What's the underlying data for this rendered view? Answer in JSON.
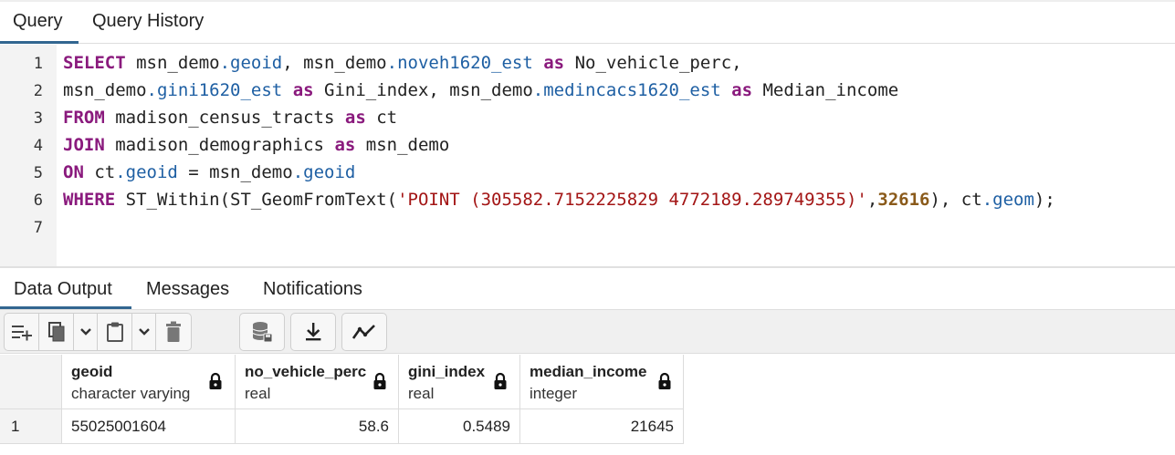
{
  "query_panel": {
    "tabs": [
      {
        "label": "Query",
        "active": true
      },
      {
        "label": "Query History",
        "active": false
      }
    ],
    "line_numbers": [
      "1",
      "2",
      "3",
      "4",
      "5",
      "6",
      "7"
    ],
    "code": {
      "l1": {
        "kw1": "SELECT",
        "t1": " msn_demo",
        "p1": ".geoid",
        "t2": ", msn_demo",
        "p2": ".noveh1620_est",
        "t3": " ",
        "kw2": "as",
        "t4": " No_vehicle_perc,"
      },
      "l2": {
        "t1": "msn_demo",
        "p1": ".gini1620_est",
        "t2": " ",
        "kw1": "as",
        "t3": " Gini_index, msn_demo",
        "p2": ".medincacs1620_est",
        "t4": " ",
        "kw2": "as",
        "t5": " Median_income"
      },
      "l3": {
        "kw1": "FROM",
        "t1": " madison_census_tracts ",
        "kw2": "as",
        "t2": " ct"
      },
      "l4": {
        "kw1": "JOIN",
        "t1": " madison_demographics ",
        "kw2": "as",
        "t2": " msn_demo"
      },
      "l5": {
        "kw1": "ON",
        "t1": " ct",
        "p1": ".geoid",
        "t2": " = msn_demo",
        "p2": ".geoid"
      },
      "l6": {
        "kw1": "WHERE",
        "t1": " ST_Within(ST_GeomFromText(",
        "s1": "'POINT (305582.7152225829 4772189.289749355)'",
        "t2": ",",
        "n1": "32616",
        "t3": "), ct",
        "p1": ".geom",
        "t4": ");"
      }
    }
  },
  "output_panel": {
    "tabs": [
      {
        "label": "Data Output",
        "active": true
      },
      {
        "label": "Messages",
        "active": false
      },
      {
        "label": "Notifications",
        "active": false
      }
    ],
    "toolbar_icons": [
      "add-row-icon",
      "copy-icon",
      "chevron-down-icon",
      "paste-icon",
      "chevron-down-icon",
      "delete-icon",
      "save-data-icon",
      "download-icon",
      "graph-visualiser-icon"
    ],
    "columns": [
      {
        "name": "geoid",
        "type": "character varying",
        "locked": true
      },
      {
        "name": "no_vehicle_perc",
        "type": "real",
        "locked": true
      },
      {
        "name": "gini_index",
        "type": "real",
        "locked": true
      },
      {
        "name": "median_income",
        "type": "integer",
        "locked": true
      }
    ],
    "rows": [
      {
        "row_number": "1",
        "cells": [
          "55025001604",
          "58.6",
          "0.5489",
          "21645"
        ]
      }
    ]
  },
  "colors": {
    "accent": "#326690",
    "keyword": "#8a1a7d",
    "property": "#1e5fa3",
    "string": "#a31515",
    "number": "#8a5a1a"
  }
}
